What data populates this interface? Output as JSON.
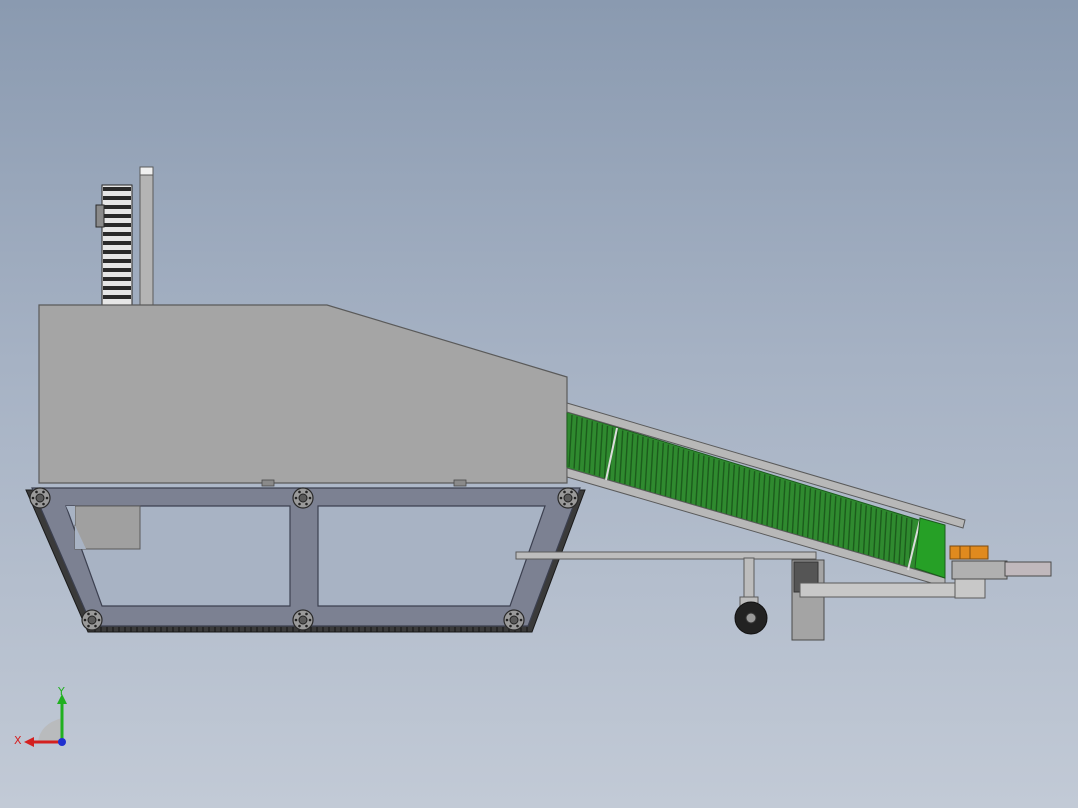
{
  "viewport": {
    "background_top": "#8a9ab0",
    "background_bottom": "#c2cad6"
  },
  "model": {
    "colors": {
      "housing": "#a5a5a5",
      "housing_edge": "#5a5a5a",
      "frame": "#7c8192",
      "frame_edge": "#3c4050",
      "track": "#3a3a3a",
      "belt": "#2f8a2f",
      "belt_dark": "#1c5c1c",
      "conveyor_rail": "#b8b8b8",
      "gear_light": "#e6e6e6",
      "gear_dark": "#2a2a2a",
      "bracket": "#b4b4b4",
      "accent_part": "#e08a1e",
      "wheel": "#222222"
    }
  },
  "triad": {
    "x_label": "X",
    "y_label": "Y",
    "x_color": "#d42020",
    "y_color": "#20b020",
    "z_color": "#2030d0"
  }
}
